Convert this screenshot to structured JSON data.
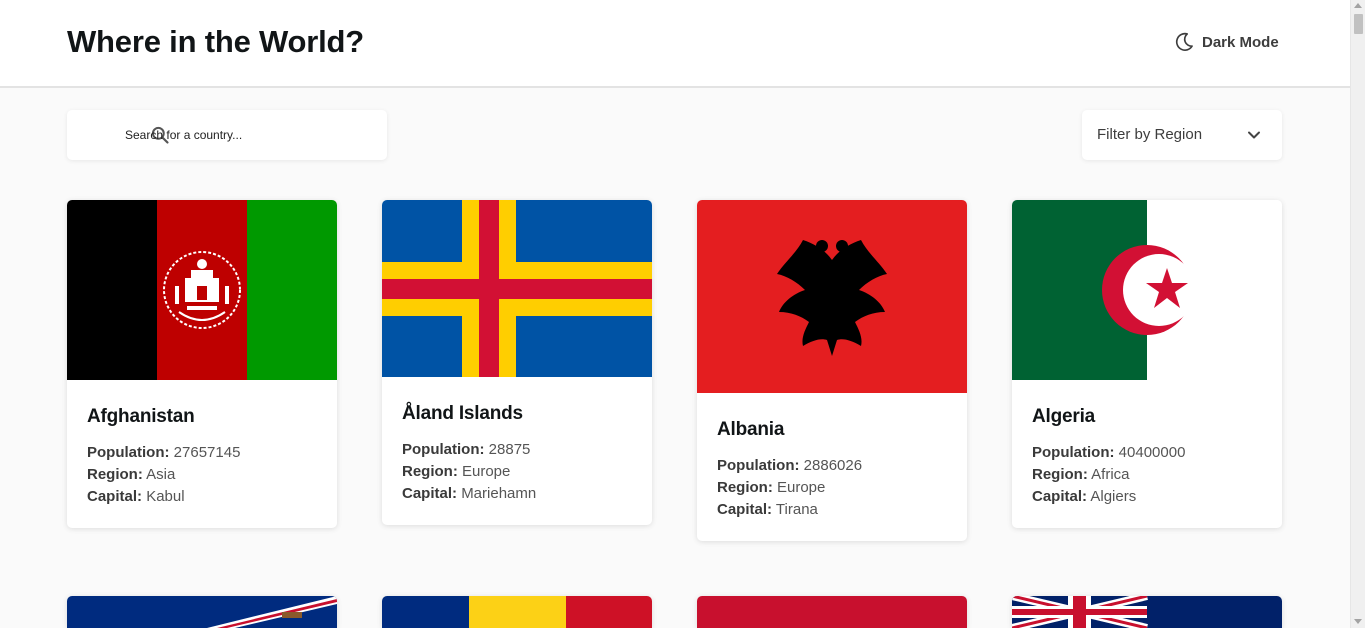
{
  "header": {
    "title": "Where in the World?",
    "theme_toggle_label": "Dark Mode",
    "theme_toggle_icon": "moon-icon"
  },
  "controls": {
    "search": {
      "placeholder": "Search for a country...",
      "value": "",
      "icon": "search-icon"
    },
    "filter": {
      "label": "Filter by Region",
      "icon": "chevron-down-icon"
    }
  },
  "labels": {
    "population": "Population:",
    "region": "Region:",
    "capital": "Capital:"
  },
  "countries": [
    {
      "name": "Afghanistan",
      "population": "27657145",
      "region": "Asia",
      "capital": "Kabul",
      "flag_colors": [
        "#000000",
        "#be0000",
        "#009900"
      ]
    },
    {
      "name": "Åland Islands",
      "population": "28875",
      "region": "Europe",
      "capital": "Mariehamn",
      "flag_colors": [
        "#0053a5",
        "#ffce00",
        "#d21034"
      ]
    },
    {
      "name": "Albania",
      "population": "2886026",
      "region": "Europe",
      "capital": "Tirana",
      "flag_colors": [
        "#e41e20",
        "#000000"
      ]
    },
    {
      "name": "Algeria",
      "population": "40400000",
      "region": "Africa",
      "capital": "Algiers",
      "flag_colors": [
        "#006233",
        "#ffffff",
        "#d21034"
      ]
    }
  ],
  "partial_flag_colors": [
    [
      "#002b7f",
      "#ffffff",
      "#c8102e"
    ],
    [
      "#002b7f",
      "#fcd116",
      "#ce1126"
    ],
    [
      "#c8102e"
    ],
    [
      "#012169",
      "#ffffff",
      "#c8102e"
    ]
  ],
  "colors": {
    "background": "#fafafa",
    "surface": "#ffffff",
    "text": "#111517"
  }
}
